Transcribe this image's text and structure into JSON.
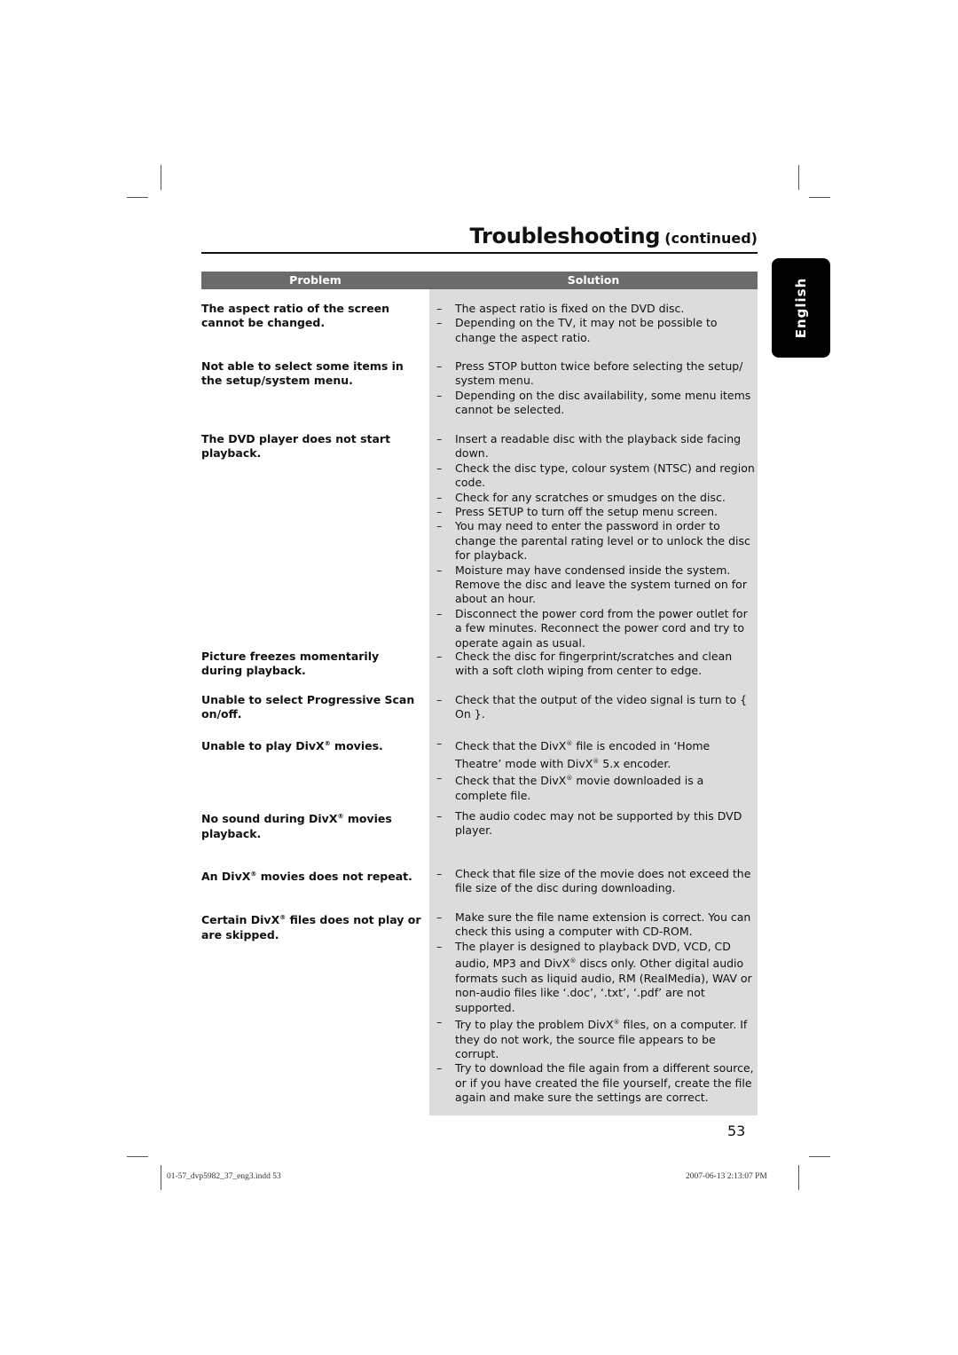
{
  "header": {
    "title": "Troubleshooting",
    "subtitle": "(continued)"
  },
  "language_tab": "English",
  "table": {
    "columns": [
      "Problem",
      "Solution"
    ],
    "rows": [
      {
        "problem": "The aspect ratio of the screen cannot be changed.",
        "solutions": [
          "The aspect ratio is fixed on the DVD disc.",
          "Depending on the TV, it may not be possible to change the aspect ratio."
        ]
      },
      {
        "problem": "Not able to select some items in the setup/system menu.",
        "solutions": [
          "Press STOP button twice before selecting the setup/ system menu.",
          "Depending on the disc availability, some menu items cannot be selected."
        ]
      },
      {
        "problem": "The DVD player does not start playback.",
        "solutions": [
          "Insert a readable disc with the playback side facing down.",
          "Check the disc type, colour system (NTSC) and region code.",
          "Check for any scratches or smudges on the disc.",
          "Press SETUP to turn off the setup menu screen.",
          "You may need to enter the password in order to change the parental rating level or to unlock the disc for playback.",
          "Moisture may have condensed inside the system. Remove the disc and leave the system turned on for about an hour.",
          "Disconnect the power cord from the power outlet for a few minutes. Reconnect the power cord and try to operate again as usual."
        ]
      },
      {
        "problem": "Picture freezes momentarily during playback.",
        "solutions": [
          "Check the disc for fingerprint/scratches and clean with a soft cloth wiping from center to edge."
        ]
      },
      {
        "problem": "Unable to select Progressive Scan on/off.",
        "solutions": [
          "Check that the output of the video signal is turn to { On }."
        ]
      },
      {
        "problem": "Unable to play DivX® movies.",
        "solutions": [
          "Check that the DivX® file is encoded in ‘Home Theatre’ mode with DivX® 5.x encoder.",
          "Check that the DivX® movie downloaded is a complete file."
        ]
      },
      {
        "problem": "No sound during DivX® movies playback.",
        "solutions": [
          "The audio codec may not be supported by this DVD player."
        ]
      },
      {
        "problem": "An DivX® movies does not repeat.",
        "solutions": [
          "Check that file size of the movie does not exceed the file size of the disc during downloading."
        ]
      },
      {
        "problem": "Certain DivX® files does not play or are skipped.",
        "solutions": [
          "Make sure the file name extension is correct. You can check this using a computer with CD-ROM.",
          "The player is designed to playback DVD, VCD, CD audio, MP3 and DivX® discs only. Other digital audio formats such as liquid audio, RM (RealMedia), WAV or non-audio files like ‘.doc’, ‘.txt’, ‘.pdf’ are not supported.",
          "Try to play the problem DivX® files, on a computer. If they do not work, the source file appears to be corrupt.",
          "Try to download the file again from a different source, or if you have created the file yourself, create the file again and make sure the settings are correct."
        ]
      }
    ]
  },
  "page_number": "53",
  "footer": {
    "file": "01-57_dvp5982_37_eng3.indd   53",
    "timestamp": "2007-06-13   2:13:07 PM"
  }
}
